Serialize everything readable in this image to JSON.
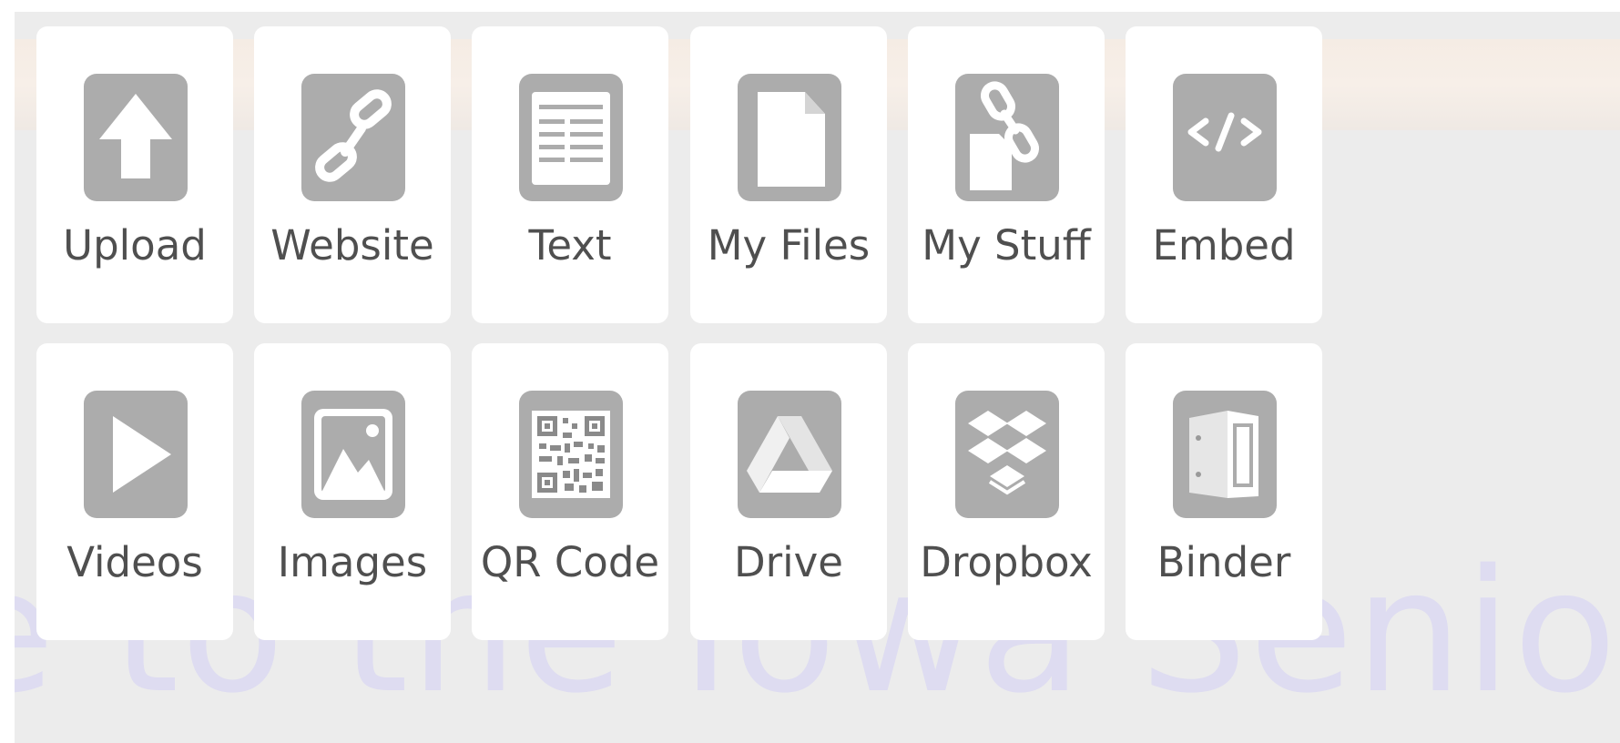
{
  "background": {
    "watermark_text": "e to the Iowa Senior Medica"
  },
  "colors": {
    "panel_bg": "#ececec",
    "tile_bg": "#ffffff",
    "icon_bg": "#acacac",
    "icon_fg": "#ffffff",
    "label_text": "#4f4f4f",
    "watermark": "#dedcf1"
  },
  "tiles": [
    {
      "label": "Upload",
      "icon": "upload-arrow-icon"
    },
    {
      "label": "Website",
      "icon": "chain-link-icon"
    },
    {
      "label": "Text",
      "icon": "text-document-icon"
    },
    {
      "label": "My Files",
      "icon": "file-icon"
    },
    {
      "label": "My Stuff",
      "icon": "file-link-icon"
    },
    {
      "label": "Embed",
      "icon": "code-embed-icon"
    },
    {
      "label": "Videos",
      "icon": "play-icon"
    },
    {
      "label": "Images",
      "icon": "image-icon"
    },
    {
      "label": "QR Code",
      "icon": "qr-code-icon"
    },
    {
      "label": "Drive",
      "icon": "google-drive-icon"
    },
    {
      "label": "Dropbox",
      "icon": "dropbox-icon"
    },
    {
      "label": "Binder",
      "icon": "binder-icon"
    }
  ]
}
